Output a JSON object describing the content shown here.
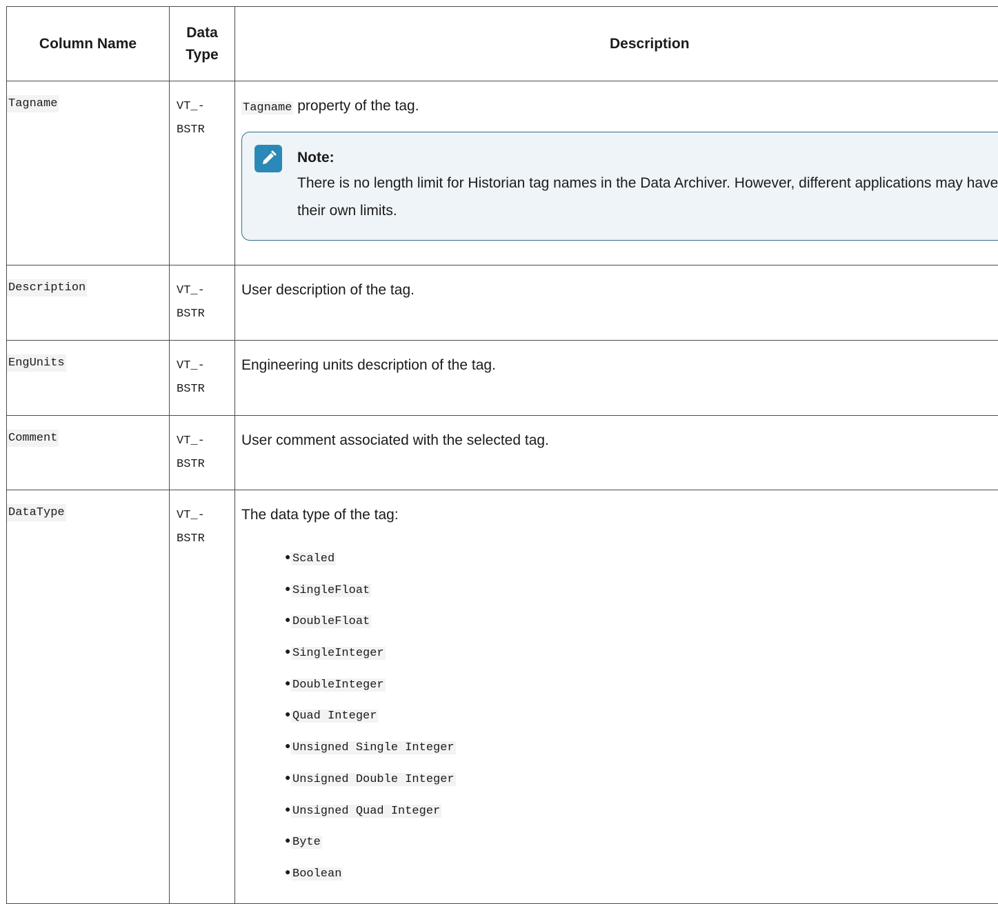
{
  "table": {
    "headers": {
      "column_name": "Column Name",
      "data_type": "Data Type",
      "description": "Description"
    },
    "rows": [
      {
        "name": "Tagname",
        "type_line1": "VT_-",
        "type_line2": "BSTR",
        "desc_code": "Tagname",
        "desc_text": " property of the tag.",
        "note": {
          "title": "Note:",
          "icon": "pencil-note-icon",
          "body": "There is no length limit for Historian tag names in the Data Archiver. However, different applications may have their own limits."
        }
      },
      {
        "name": "Description",
        "type_line1": "VT_-",
        "type_line2": "BSTR",
        "desc_text": "User description of the tag."
      },
      {
        "name": "EngUnits",
        "type_line1": "VT_-",
        "type_line2": "BSTR",
        "desc_text": "Engineering units description of the tag."
      },
      {
        "name": "Comment",
        "type_line1": "VT_-",
        "type_line2": "BSTR",
        "desc_text": "User comment associated with the selected tag."
      },
      {
        "name": "DataType",
        "type_line1": "VT_-",
        "type_line2": "BSTR",
        "desc_text": "The data type of the tag:",
        "list": [
          "Scaled",
          "SingleFloat",
          "DoubleFloat",
          "SingleInteger",
          "DoubleInteger",
          "Quad Integer",
          "Unsigned Single Integer",
          "Unsigned Double Integer",
          "Unsigned Quad Integer",
          "Byte",
          "Boolean"
        ]
      }
    ]
  },
  "colors": {
    "note_accent": "#2a89b6",
    "note_border": "#2f6f8f",
    "code_background": "#f3f3f3"
  }
}
